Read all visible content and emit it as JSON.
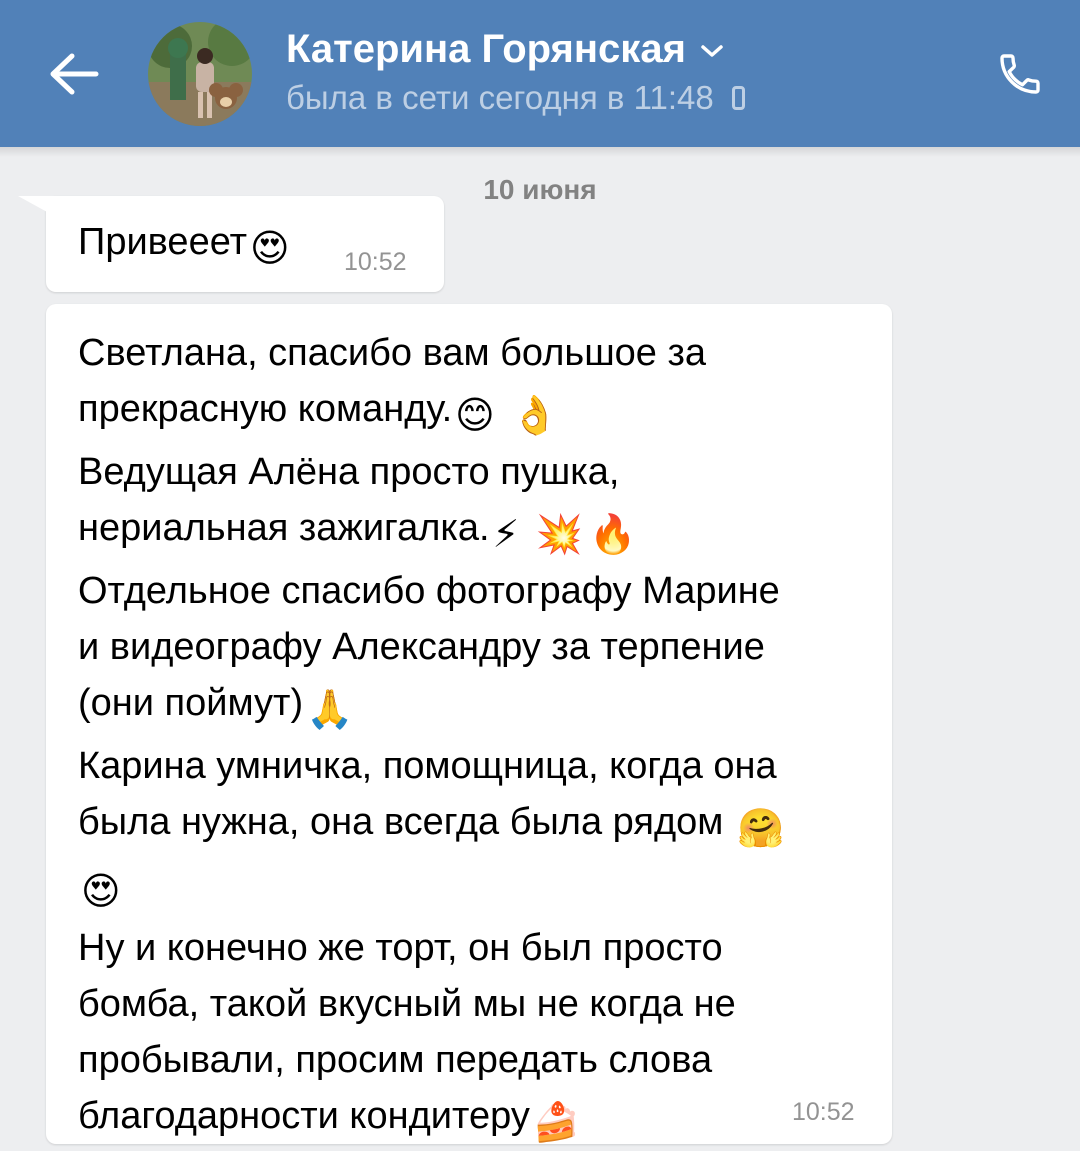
{
  "header": {
    "contact_name": "Катерина Горянская",
    "status": "была в сети сегодня в 11:48",
    "back_icon": "arrow-left-icon",
    "call_icon": "phone-icon",
    "chevron_icon": "chevron-down-icon",
    "device_icon": "mobile-icon",
    "background": "#5181b8"
  },
  "chat": {
    "date_separator": "10 июня",
    "messages": [
      {
        "parts": [
          "Привееет",
          "😍"
        ],
        "time": "10:52"
      },
      {
        "lines": [
          [
            "Светлана, спасибо вам большое за"
          ],
          [
            "прекрасную команду.",
            "😊",
            "👌"
          ],
          [
            "Ведущая Алёна просто пушка,"
          ],
          [
            "нериальная зажигалка.",
            "⚡",
            "💥",
            "🔥"
          ],
          [
            "Отдельное спасибо фотографу Марине"
          ],
          [
            "и видеографу Александру за терпение"
          ],
          [
            "(они поймут)",
            "🙏"
          ],
          [
            "Карина умничка, помощница, когда она"
          ],
          [
            "была нужна, она всегда была рядом ",
            "🤗"
          ],
          [
            "😍"
          ],
          [
            "Ну и конечно же торт, он был просто"
          ],
          [
            "бомба, такой вкусный мы не когда не"
          ],
          [
            "пробывали, просим передать слова"
          ],
          [
            "благодарности кондитеру",
            "🍰"
          ]
        ],
        "time": "10:52"
      }
    ]
  },
  "colors": {
    "chat_background": "#edeef0",
    "bubble": "#ffffff",
    "time_text": "#939393"
  }
}
